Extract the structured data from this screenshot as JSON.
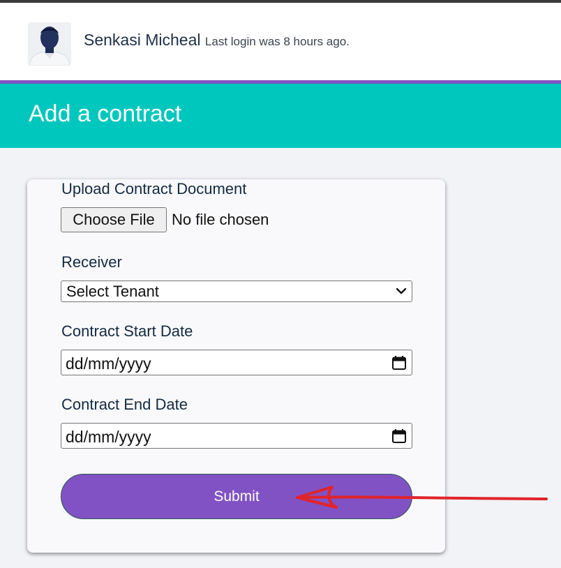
{
  "user": {
    "name": "Senkasi Micheal",
    "last_login": "Last login was 8 hours ago."
  },
  "page": {
    "title": "Add a contract"
  },
  "form": {
    "upload_label": "Upload Contract Document",
    "choose_file_label": "Choose File",
    "file_status": "No file chosen",
    "receiver_label": "Receiver",
    "receiver_selected": "Select Tenant",
    "start_date_label": "Contract Start Date",
    "start_date_placeholder": "dd/mm/yyyy",
    "end_date_label": "Contract End Date",
    "end_date_placeholder": "dd/mm/yyyy",
    "submit_label": "Submit"
  },
  "colors": {
    "banner": "#00c7bd",
    "accent": "#8152c4",
    "annotation": "#e0242b"
  },
  "icons": {
    "avatar": "user-photo",
    "select": "chevron-down-icon",
    "date": "calendar-icon"
  }
}
